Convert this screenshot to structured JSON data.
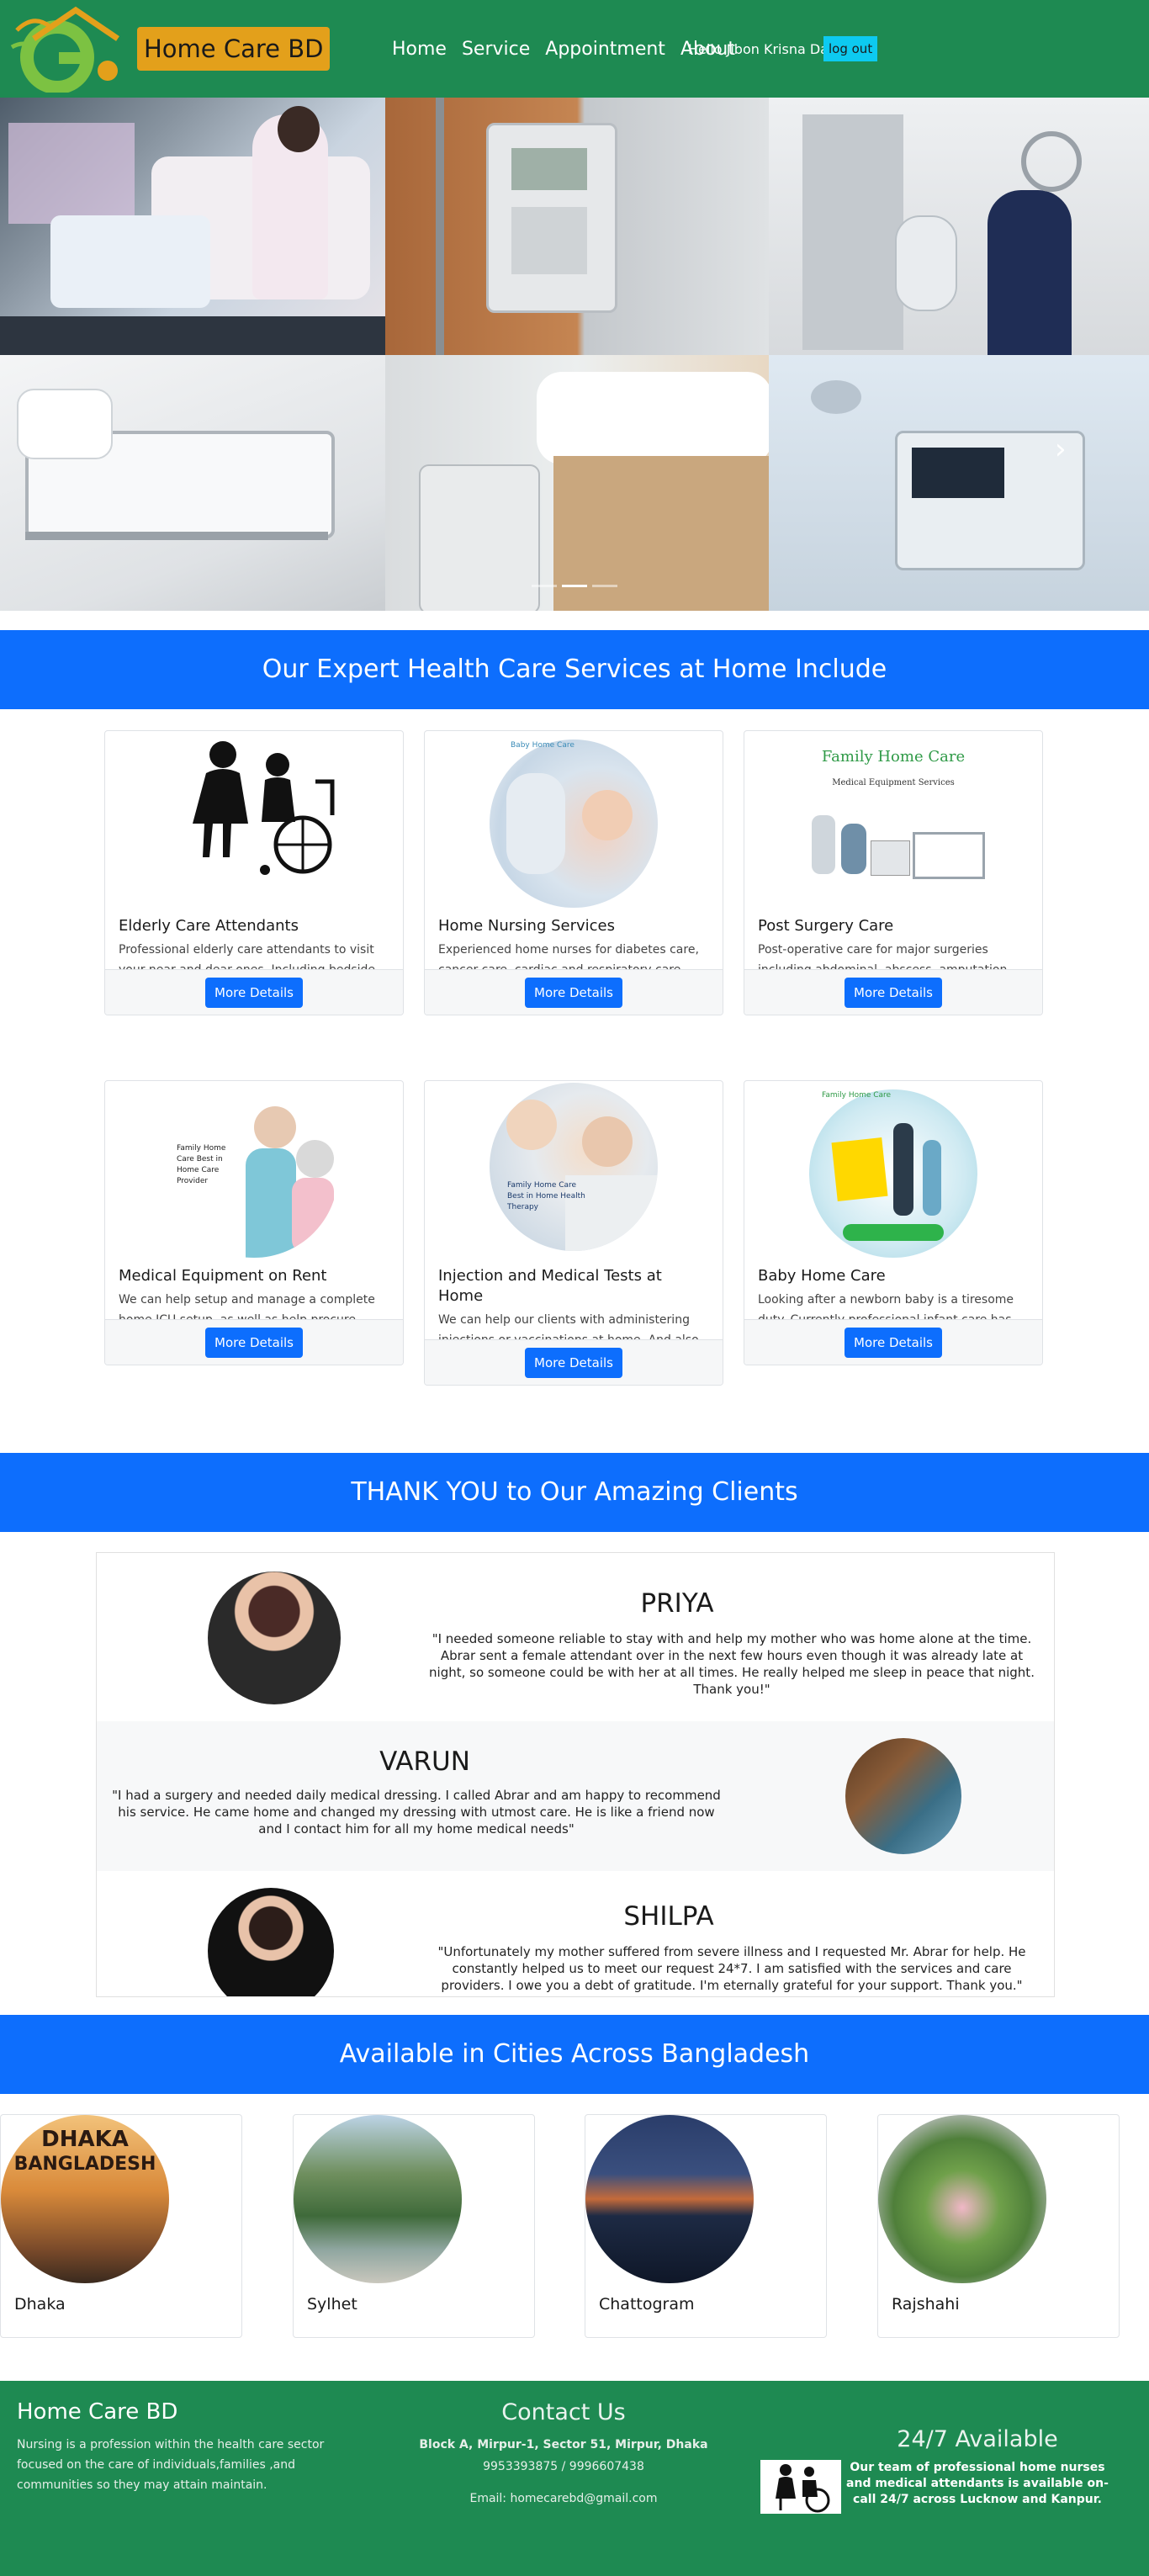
{
  "navbar": {
    "brand": "Home Care BD",
    "links": [
      "Home",
      "Service",
      "Appointment",
      "About"
    ],
    "greeting": "Hello Jibon Krisna Das",
    "logout_label": "log out"
  },
  "hero": {
    "prev_icon": "chevron-left-icon",
    "next_icon": "chevron-right-icon",
    "slides": 3,
    "active_slide": 2
  },
  "services": {
    "heading": "Our Expert Health Care Services at Home Include",
    "button_label": "More Details",
    "cards": [
      {
        "title": "Elderly Care Attendants",
        "text": "Professional elderly care attendants to visit your near and dear ones. Including bedside attendants"
      },
      {
        "title": "Home Nursing Services",
        "text": "Experienced home nurses for diabetes care, cancer care, cardiac and respiratory care, orthopedic car",
        "image_text": "Baby Home Care"
      },
      {
        "title": "Post Surgery Care",
        "text": "Post-operative care for major surgeries including abdominal, abscess, amputation, angioplasty, appen",
        "image_text": "Family Home Care",
        "image_sub": "Medical Equipment Services"
      },
      {
        "title": "Medical Equipment on Rent",
        "text": "We can help setup and manage a complete home ICU setup, as well as help procure professional medical",
        "image_text": "Family Home Care Best in Home Care Provider"
      },
      {
        "title": "Injection and Medical Tests at Home",
        "text": "We can help our clients with administering injections or vaccinations at home. And also help arrange",
        "image_text": "Family Home Care Best in Home Health Therapy"
      },
      {
        "title": "Baby Home Care",
        "text": "Looking after a newborn baby is a tiresome duty. Currently professional infant care has gained recog",
        "image_text": "Family Home Care"
      }
    ]
  },
  "testimonials": {
    "heading": "THANK YOU to Our Amazing Clients",
    "items": [
      {
        "name": "PRIYA",
        "quote": "\"I needed someone reliable to stay with and help my mother who was home alone at the time. Abrar sent a female attendant over in the next few hours even though it was already late at night, so someone could be with her at all times. He really helped me sleep in peace that night. Thank you!\""
      },
      {
        "name": "VARUN",
        "quote": "\"I had a surgery and needed daily medical dressing. I called Abrar and am happy to recommend his service. He came home and changed my dressing with utmost care. He is like a friend now and I contact him for all my home medical needs\""
      },
      {
        "name": "SHILPA",
        "quote": "\"Unfortunately my mother suffered from severe illness and I requested Mr. Abrar for help. He constantly helped us to meet our request 24*7. I am satisfied with the services and care providers. I owe you a debt of gratitude. I'm eternally grateful for your support. Thank you.\""
      }
    ]
  },
  "cities": {
    "heading": "Available in Cities Across Bangladesh",
    "dhaka_image_text": [
      "DHAKA",
      "BANGLADESH"
    ],
    "items": [
      "Dhaka",
      "Sylhet",
      "Chattogram",
      "Rajshahi"
    ]
  },
  "footer": {
    "brand": "Home Care BD",
    "description": "Nursing is a profession within the health care sector focused on the care of individuals,families ,and communities so they may attain maintain.",
    "contact_title": "Contact Us",
    "address": "Block A, Mirpur-1, Sector 51, Mirpur, Dhaka",
    "phones": "9953393875 / 9996607438",
    "email": "Email: homecarebd@gmail.com",
    "availability_title": "24/7 Available",
    "availability_text": "Our team of professional home nurses and medical attendants is available on-call 24/7 across Lucknow and Kanpur."
  },
  "colors": {
    "navbar": "#1e8a52",
    "brand_badge": "#e3a01b",
    "banner": "#0d6efd",
    "button": "#0d6efd",
    "logout": "#0dcaf0"
  }
}
